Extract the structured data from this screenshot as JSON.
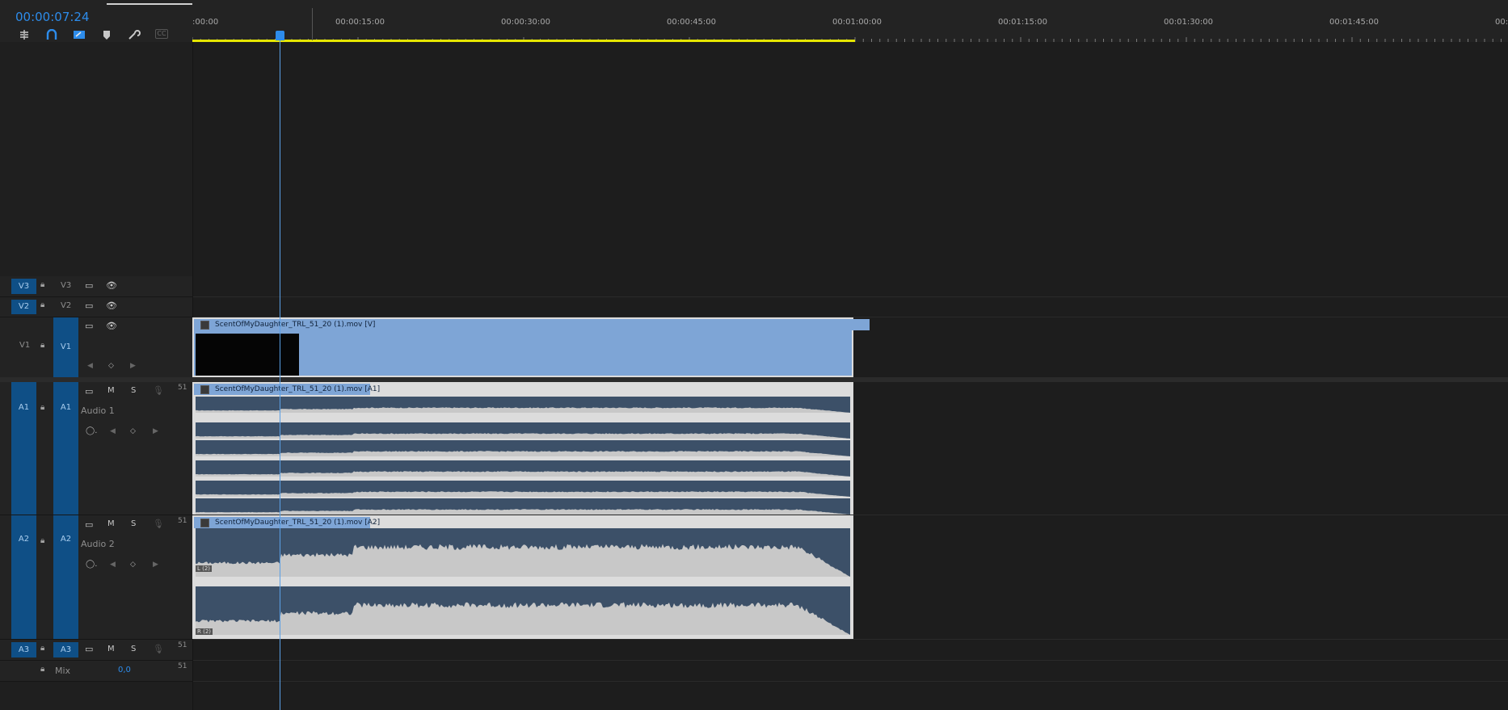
{
  "timecode": "00:00:07:24",
  "ruler": {
    "labels": [
      ":00:00",
      "00:00:15:00",
      "00:00:30:00",
      "00:00:45:00",
      "00:01:00:00",
      "00:01:15:00",
      "00:01:30:00",
      "00:01:45:00",
      "00:"
    ]
  },
  "toolbar": {
    "icons": [
      "insert-overwrite-icon",
      "snap-magnet-icon",
      "linked-selection-icon",
      "add-marker-icon",
      "wrench-settings-icon",
      "captions-cc-icon"
    ],
    "cc_label": "CC"
  },
  "tracks": {
    "v3": {
      "src": "V3",
      "tgt": "V3"
    },
    "v2": {
      "src": "V2",
      "tgt": "V2"
    },
    "v1": {
      "src": "V1",
      "tgt": "V1"
    },
    "a1": {
      "src": "A1",
      "tgt": "A1",
      "name": "Audio 1",
      "m": "M",
      "s": "S",
      "channels": "51"
    },
    "a2": {
      "src": "A2",
      "tgt": "A2",
      "name": "Audio 2",
      "m": "M",
      "s": "S",
      "channels": "51"
    },
    "a3": {
      "src": "A3",
      "tgt": "A3",
      "m": "M",
      "s": "S",
      "channels": "51"
    },
    "mix": {
      "label": "Mix",
      "value": "0,0",
      "channels": "51"
    }
  },
  "clips": {
    "video": "ScentOfMyDaughter_TRL_51_20 (1).mov [V]",
    "audio1": "ScentOfMyDaughter_TRL_51_20 (1).mov [A1]",
    "audio2": "ScentOfMyDaughter_TRL_51_20 (1).mov [A2]"
  },
  "audio2_channel_tags": {
    "left": "L (2)",
    "right": "R (2)"
  },
  "colors": {
    "accent": "#2d8ceb",
    "track_target": "#0f4f86",
    "clip_video": "#7ea5d6",
    "waveform_bg": "#3c5068",
    "waveform": "#c8c8c8",
    "work_area": "#e6e600"
  }
}
